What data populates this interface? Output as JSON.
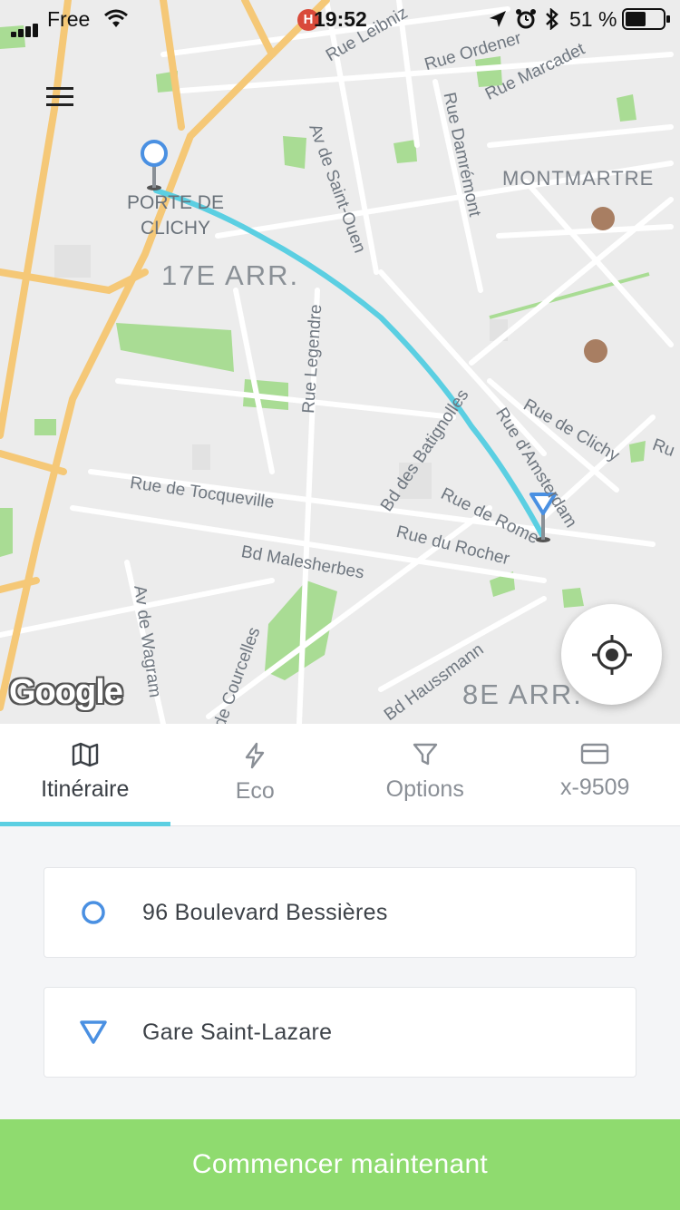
{
  "status_bar": {
    "carrier": "Free",
    "time": "19:52",
    "badge": "H",
    "battery_percent": "51 %"
  },
  "map": {
    "labels": {
      "porte_de_clichy": "PORTE DE\nCLICHY",
      "district_17": "17E ARR.",
      "district_8": "8E ARR.",
      "montmartre": "MONTMARTRE",
      "rue_leibniz": "Rue Leibniz",
      "rue_ordener": "Rue Ordener",
      "rue_marcadet": "Rue Marcadet",
      "rue_damremont": "Rue Damrémont",
      "av_saint_ouen": "Av de Saint-Ouen",
      "rue_legendre": "Rue Legendre",
      "bd_batignolles": "Bd des Batignolles",
      "rue_clichy": "Rue de Clichy",
      "rue_amsterdam": "Rue d'Amsterdam",
      "rue_tocqueville": "Rue de Tocqueville",
      "rue_rome": "Rue de Rome",
      "rue_rocher": "Rue du Rocher",
      "bd_malesherbes": "Bd Malesherbes",
      "av_wagram": "Av de Wagram",
      "bd_haussmann": "Bd Haussmann",
      "de_courcelles": "de Courcelles",
      "rue_partial": "Ru"
    },
    "provider_logo": "Google",
    "route_color": "#5bcfe2"
  },
  "tabs": [
    {
      "label": "Itinéraire",
      "icon": "map-icon",
      "active": true
    },
    {
      "label": "Eco",
      "icon": "lightning-icon",
      "active": false
    },
    {
      "label": "Options",
      "icon": "filter-icon",
      "active": false
    },
    {
      "label": "x-9509",
      "icon": "credit-card-icon",
      "active": false
    }
  ],
  "form": {
    "origin": "96 Boulevard Bessières",
    "destination": "Gare Saint-Lazare"
  },
  "cta": {
    "label": "Commencer maintenant",
    "color": "#8fdb6f"
  },
  "colors": {
    "accent": "#5bcfe2",
    "pin_blue": "#4a90e2"
  }
}
